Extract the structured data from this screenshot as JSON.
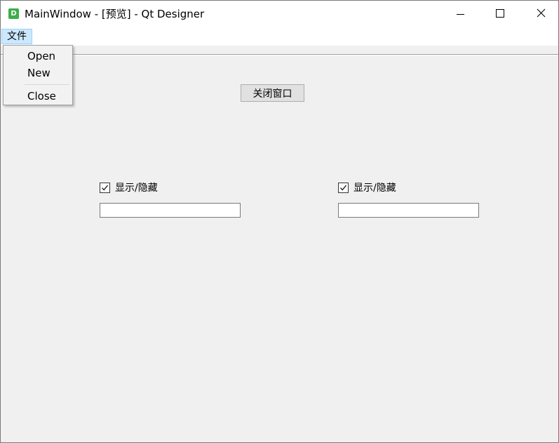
{
  "window": {
    "title": "MainWindow - [预览] - Qt Designer",
    "app_icon_letter": "D",
    "app_icon_color": "#3dae49"
  },
  "menubar": {
    "file_label": "文件"
  },
  "file_menu": {
    "items": [
      {
        "label": "Open"
      },
      {
        "label": "New"
      },
      {
        "label": "Close"
      }
    ]
  },
  "main": {
    "close_button_label": "关闭窗口",
    "left_group": {
      "checkbox_label": "显示/隐藏",
      "checked": true,
      "input_value": ""
    },
    "right_group": {
      "checkbox_label": "显示/隐藏",
      "checked": true,
      "input_value": ""
    }
  },
  "colors": {
    "window_bg": "#f0f0f0",
    "menu_highlight": "#cce8ff"
  }
}
